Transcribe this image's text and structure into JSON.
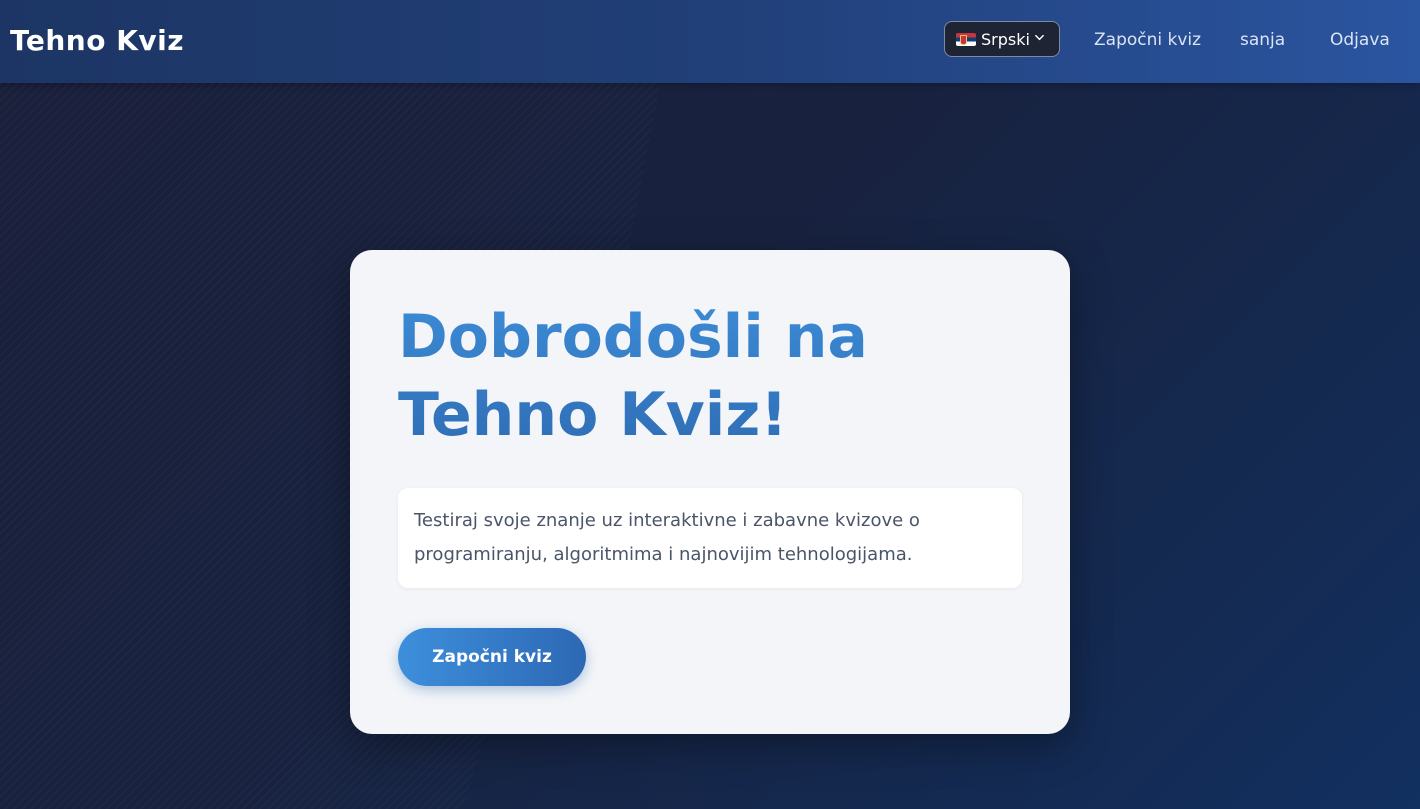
{
  "navbar": {
    "brand": "Tehno Kviz",
    "language": {
      "selected": "Srpski",
      "flag_icon": "serbia-flag-icon"
    },
    "links": {
      "start_quiz": "Započni kviz",
      "username": "sanja",
      "logout": "Odjava"
    }
  },
  "hero": {
    "title_line1": "Dobrodošli na",
    "title_line2": "Tehno Kviz!",
    "description_line1": "Testiraj svoje znanje uz interaktivne i zabavne kvizove o",
    "description_line2": "programiranju, algoritmima i najnovijim tehnologijama.",
    "cta_label": "Započni kviz"
  },
  "colors": {
    "accent": "#3a84cc",
    "navbar": "#213f78",
    "background": "#18223f"
  }
}
